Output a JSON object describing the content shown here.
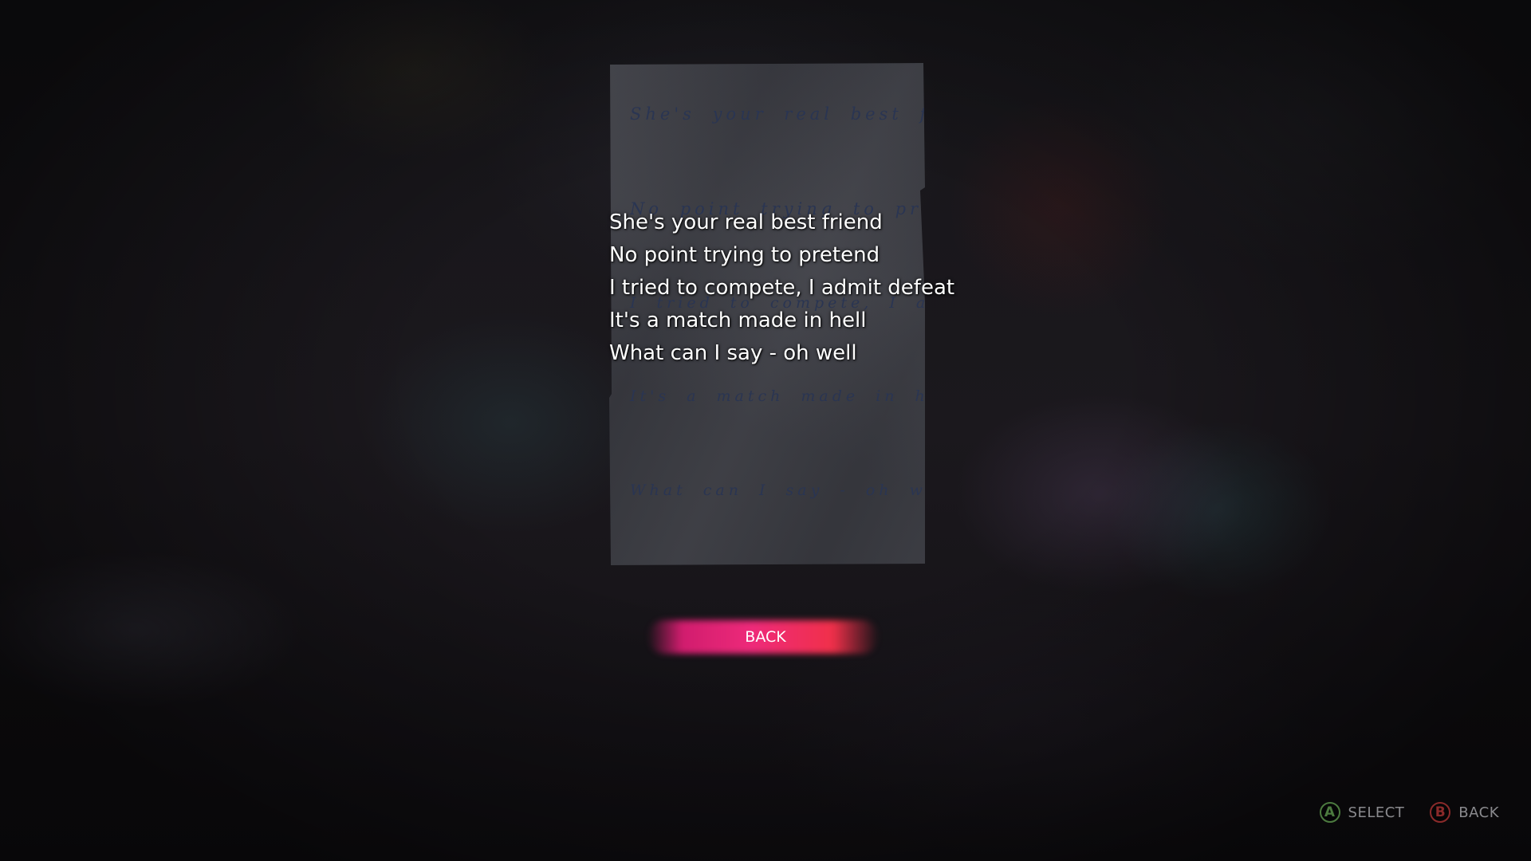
{
  "note": {
    "handwritten_lines": [
      "She's your real best friend",
      "No point trying to pretend",
      "I tried to compete, I admit defeat",
      "It's a match made in hell",
      "What can I say - oh well"
    ]
  },
  "subtitles": {
    "lines": [
      "She's your real best friend",
      "No point trying to pretend",
      "I tried to compete, I admit defeat",
      "It's a match made in hell",
      "What can I say - oh well"
    ]
  },
  "menu": {
    "back_label": "BACK",
    "accent_color": "#ee2a7a"
  },
  "prompts": {
    "select": {
      "glyph": "A",
      "label": "SELECT",
      "color": "#4c7a3f",
      "icon": "a-button-icon"
    },
    "back": {
      "glyph": "B",
      "label": "BACK",
      "color": "#8a2a2a",
      "icon": "b-button-icon"
    }
  }
}
